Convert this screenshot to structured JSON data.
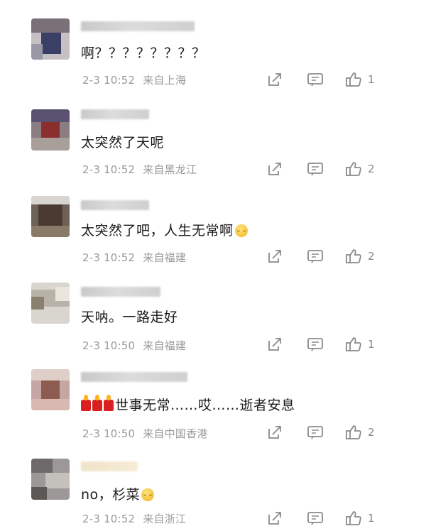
{
  "comments": [
    {
      "text": "啊？？？？？？？？",
      "time": "2-3 10:52",
      "location": "来自上海",
      "likes": "1"
    },
    {
      "text": "太突然了天呢",
      "time": "2-3 10:52",
      "location": "来自黑龙江",
      "likes": "2"
    },
    {
      "text": "太突然了吧，人生无常啊",
      "time": "2-3 10:52",
      "location": "来自福建",
      "likes": "2"
    },
    {
      "text": "天呐。一路走好",
      "time": "2-3 10:50",
      "location": "来自福建",
      "likes": "1"
    },
    {
      "text": "世事无常……哎……逝者安息",
      "time": "2-3 10:50",
      "location": "来自中国香港",
      "likes": "2"
    },
    {
      "text": "no，杉菜",
      "time": "2-3 10:52",
      "location": "来自浙江",
      "likes": "1"
    }
  ],
  "icons": {
    "share": "share-icon",
    "comment": "comment-icon",
    "like": "thumbs-up-icon",
    "crying_emoji": "crying-emoji",
    "candle_emoji": "candle-emoji"
  },
  "colors": {
    "text": "#1b1b1b",
    "meta": "#9a9a9a",
    "icon": "#8a8a8a"
  }
}
